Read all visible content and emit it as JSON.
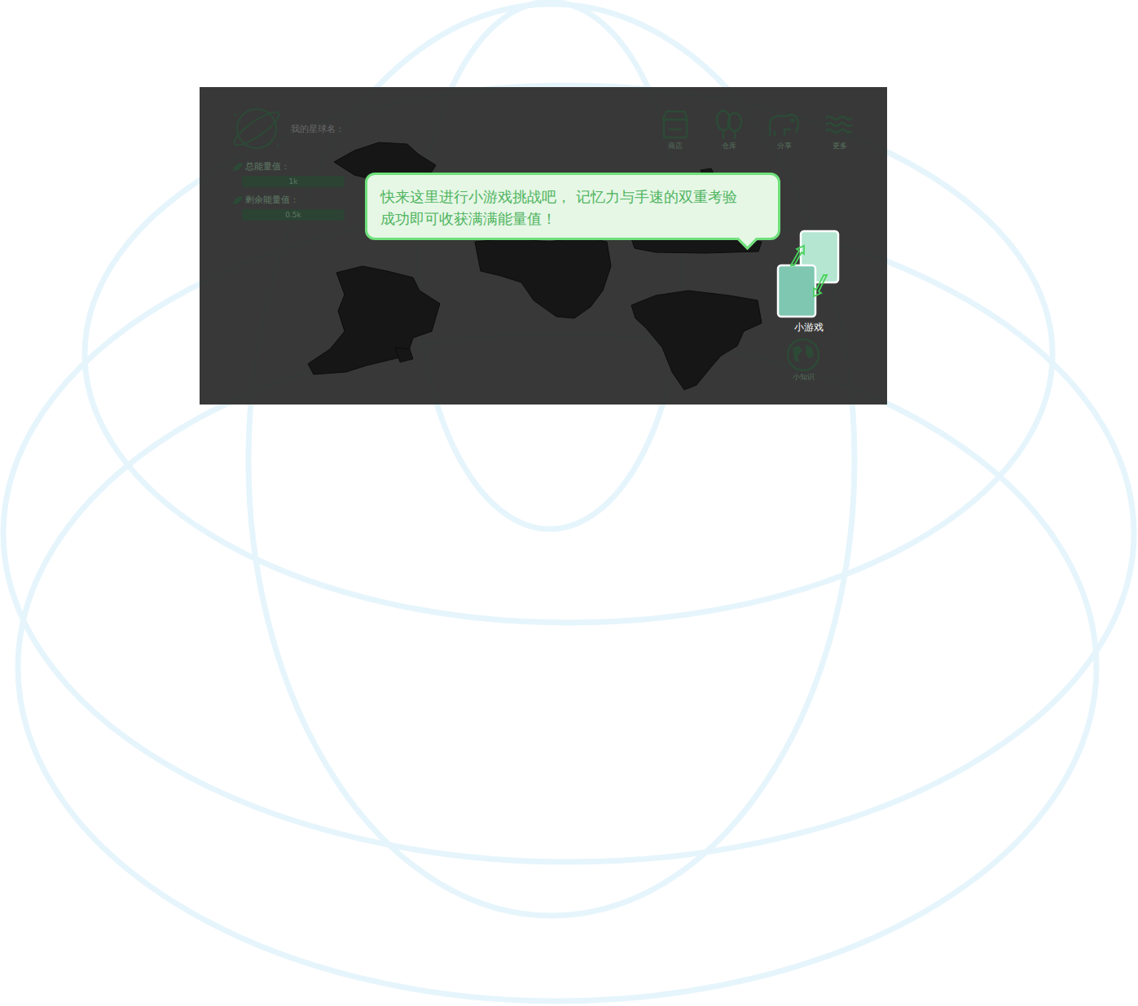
{
  "planet": {
    "name_label": "我的星球名："
  },
  "stats": [
    {
      "label": "总能量值：",
      "value": "1k"
    },
    {
      "label": "剩余能量值：",
      "value": "0.5k"
    }
  ],
  "toolbar": [
    {
      "label": "商店"
    },
    {
      "label": "仓库"
    },
    {
      "label": "分享"
    },
    {
      "label": "更多"
    }
  ],
  "tooltip": {
    "lines": [
      "快来这里进行小游戏挑战吧，  记忆力与手速的双重考验",
      "成功即可收获满满能量值！"
    ]
  },
  "side_buttons": [
    {
      "label": "小游戏",
      "highlighted": true
    },
    {
      "label": "小知识",
      "highlighted": false
    }
  ]
}
